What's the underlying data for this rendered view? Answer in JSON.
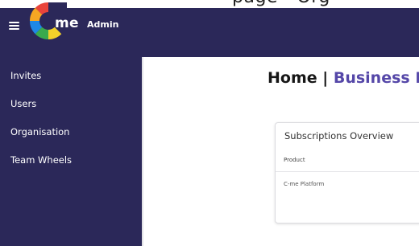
{
  "header": {
    "top_strip_text": "page - Org",
    "brand": "me",
    "brand_sub": "Admin",
    "logo_colors": [
      "#e9443b",
      "#f6a623",
      "#3aaa4d",
      "#1e88e5",
      "#f2d12a"
    ]
  },
  "sidebar": {
    "items": [
      {
        "label": "Invites"
      },
      {
        "label": "Users"
      },
      {
        "label": "Organisation"
      },
      {
        "label": "Team Wheels"
      }
    ]
  },
  "main": {
    "title_prefix": "Home",
    "title_separator": "|",
    "org_name": "Business Lt"
  },
  "subscriptions": {
    "title": "Subscriptions Overview",
    "column_product": "Product",
    "rows": [
      {
        "product": "C-me Platform"
      }
    ]
  },
  "colors": {
    "sidebar_bg": "#2b2859",
    "accent": "#5547a8"
  }
}
